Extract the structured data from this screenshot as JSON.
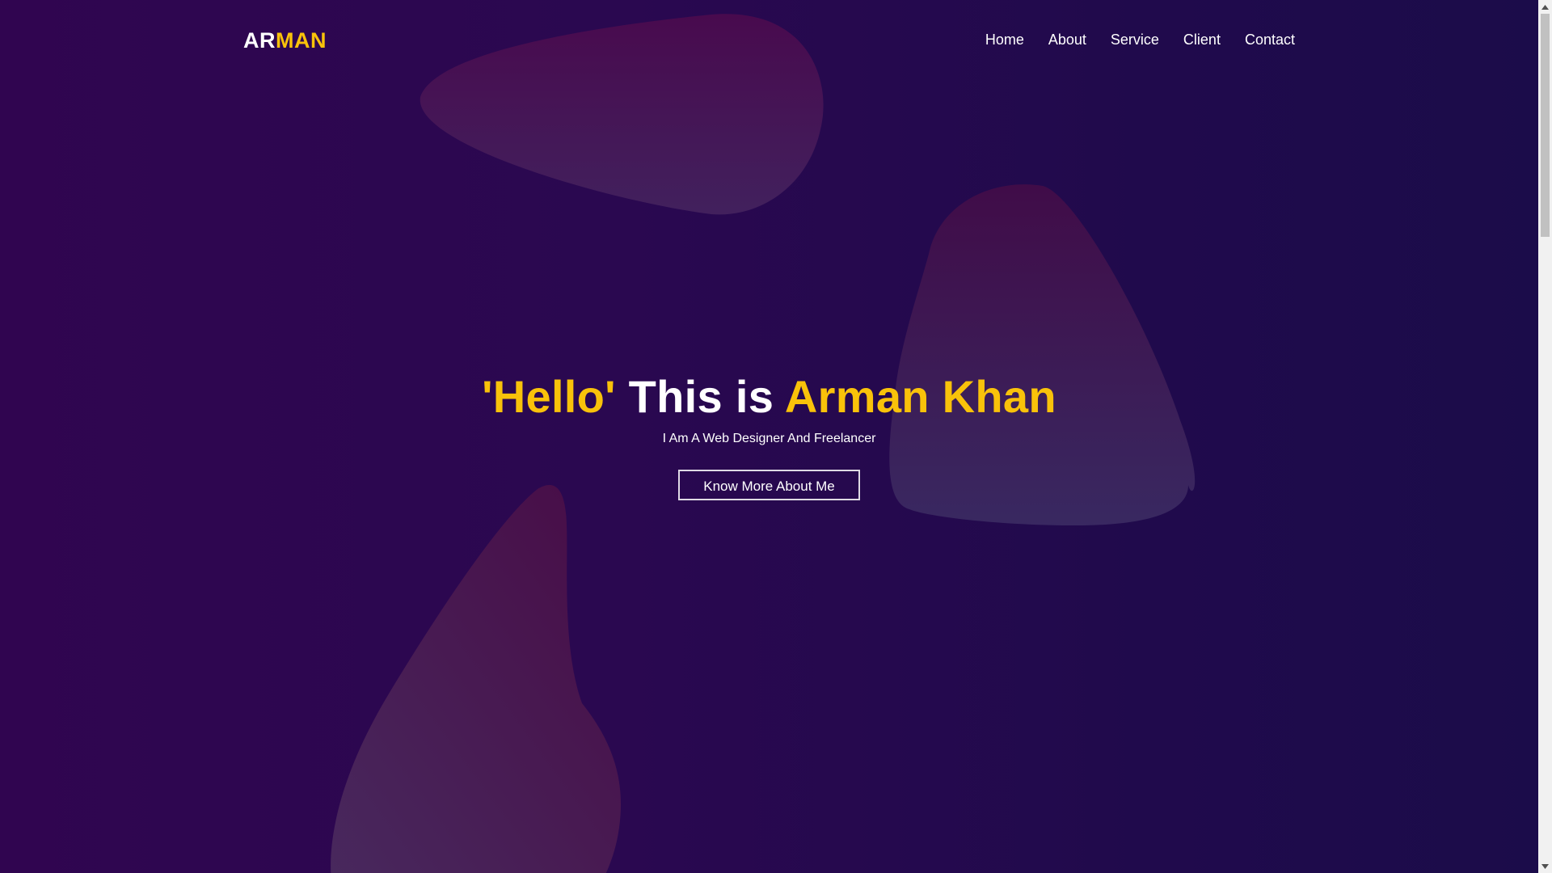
{
  "logo": {
    "part1": "AR",
    "part2": "MAN"
  },
  "nav": {
    "items": [
      {
        "label": "Home"
      },
      {
        "label": "About"
      },
      {
        "label": "Service"
      },
      {
        "label": "Client"
      },
      {
        "label": "Contact"
      }
    ]
  },
  "hero": {
    "title_part1": "'Hello'",
    "title_part2": " This is ",
    "title_part3": "Arman Khan",
    "subtitle": "I Am A Web Designer And Freelancer",
    "button_label": "Know More About Me"
  },
  "colors": {
    "accent": "#f9c20a",
    "background_start": "#300550",
    "background_end": "#1b0c4a",
    "text": "#ffffff"
  },
  "icons": {
    "scroll_up": "triangle-up-icon",
    "scroll_down": "triangle-down-icon"
  }
}
